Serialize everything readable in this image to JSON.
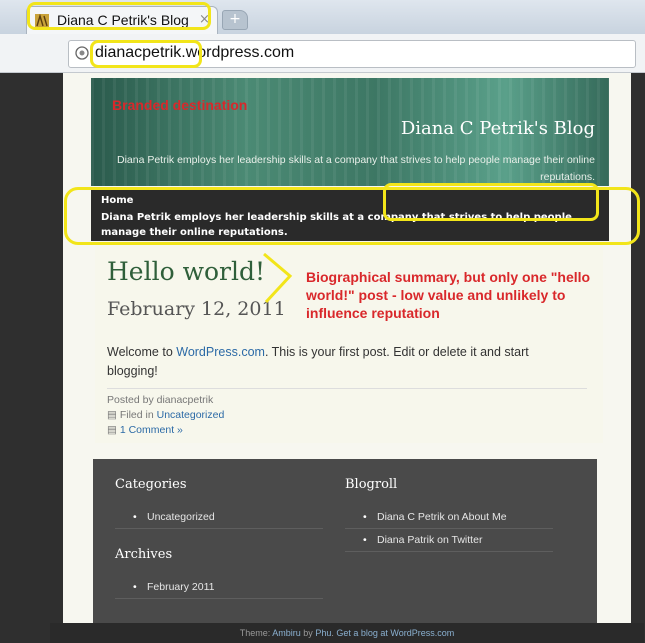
{
  "browser": {
    "tab_title": "Diana C Petrik's Blog",
    "tab_close": "×",
    "new_tab": "+",
    "url_highlight": "dianacpetrik.",
    "url_rest": "wordpress.com"
  },
  "header": {
    "site_title": "Diana C Petrik's Blog",
    "description": "Diana Petrik employs her leadership skills at a company that strives to help people manage their online reputations."
  },
  "nav": {
    "home": "Home",
    "description": "Diana Petrik employs her leadership skills at a company that strives to help people manage their online reputations."
  },
  "post": {
    "title": "Hello world!",
    "date": "February 12, 2011",
    "body_prefix": "Welcome to ",
    "body_link": "WordPress.com",
    "body_suffix": ". This is your first post. Edit or delete it and start blogging!",
    "posted_by": "Posted by dianacpetrik",
    "filed_in_prefix": "Filed in ",
    "filed_in_link": "Uncategorized",
    "comments": "1 Comment »"
  },
  "sidebar": {
    "categories_heading": "Categories",
    "categories": [
      "Uncategorized"
    ],
    "archives_heading": "Archives",
    "archives": [
      "February 2011"
    ],
    "blogroll_heading": "Blogroll",
    "blogroll": [
      "Diana C Petrik on About Me",
      "Diana Patrik on Twitter"
    ]
  },
  "footer": {
    "theme_prefix": "Theme: ",
    "theme_link": "Ambiru",
    "by": " by ",
    "author_link": "Phu",
    "sep": ". ",
    "wp_link": "Get a blog at WordPress.com"
  },
  "annotations": {
    "branded": "Branded destination",
    "summary": "Biographical summary, but only one \"hello world!\" post  - low value and unlikely to influence reputation"
  },
  "colors": {
    "annotation_text": "#d9282b",
    "highlight": "#f2e51a",
    "link": "#2c6aa6"
  },
  "icons": {
    "tab_favicon": "blog-favicon-icon",
    "url_icon": "globe-icon",
    "filed_icon": "folder-icon",
    "comment_icon": "comment-icon"
  }
}
